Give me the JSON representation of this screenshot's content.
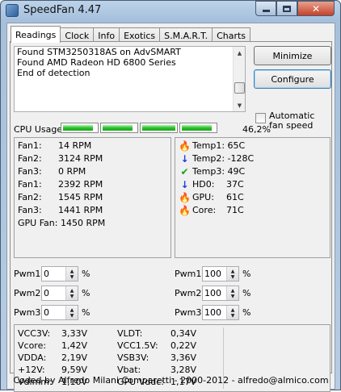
{
  "window": {
    "title": "SpeedFan 4.47",
    "title_icon": "speedfan-app-icon",
    "controls": [
      "minimize-window",
      "maximize-window",
      "close-window"
    ]
  },
  "tabs": [
    "Readings",
    "Clock",
    "Info",
    "Exotics",
    "S.M.A.R.T.",
    "Charts"
  ],
  "active_tab": "Readings",
  "log": {
    "lines": [
      "Found STM3250318AS on AdvSMART",
      "Found AMD Radeon HD 6800 Series",
      "End of detection"
    ]
  },
  "buttons": {
    "minimize": "Minimize",
    "configure": "Configure"
  },
  "auto_fan_speed": {
    "label": "Automatic fan speed",
    "checked": false
  },
  "cpu_usage": {
    "label": "CPU Usage",
    "bars": [
      0.9,
      0.9,
      1.0,
      0.9
    ],
    "percent": "46,2%"
  },
  "fans": [
    {
      "label": "Fan1:",
      "value": "14 RPM"
    },
    {
      "label": "Fan2:",
      "value": "3124 RPM"
    },
    {
      "label": "Fan3:",
      "value": "0 RPM"
    },
    {
      "label": "Fan1:",
      "value": "2392 RPM"
    },
    {
      "label": "Fan2:",
      "value": "1545 RPM"
    },
    {
      "label": "Fan3:",
      "value": "1441 RPM"
    },
    {
      "label": "GPU Fan:",
      "value": "1450 RPM"
    }
  ],
  "temps": [
    {
      "label": "Temp1:",
      "value": "65C",
      "icon": "flame-icon",
      "icon_color": "#e05a00"
    },
    {
      "label": "Temp2:",
      "value": "-128C",
      "icon": "arrow-down-icon",
      "icon_color": "#1a3fd8"
    },
    {
      "label": "Temp3:",
      "value": "49C",
      "icon": "check-icon",
      "icon_color": "#12a21b"
    },
    {
      "label": "HD0:",
      "value": "37C",
      "icon": "arrow-down-icon",
      "icon_color": "#1a3fd8"
    },
    {
      "label": "GPU:",
      "value": "61C",
      "icon": "flame-icon",
      "icon_color": "#e05a00"
    },
    {
      "label": "Core:",
      "value": "71C",
      "icon": "flame-icon",
      "icon_color": "#e05a00"
    }
  ],
  "pwm_left": [
    {
      "label": "Pwm1:",
      "value": "0",
      "unit": "%"
    },
    {
      "label": "Pwm2:",
      "value": "0",
      "unit": "%"
    },
    {
      "label": "Pwm3:",
      "value": "0",
      "unit": "%"
    }
  ],
  "pwm_right": [
    {
      "label": "Pwm1:",
      "value": "100",
      "unit": "%"
    },
    {
      "label": "Pwm2:",
      "value": "100",
      "unit": "%"
    },
    {
      "label": "Pwm3:",
      "value": "100",
      "unit": "%"
    }
  ],
  "voltages_left": [
    {
      "label": "VCC3V:",
      "value": "3,33V"
    },
    {
      "label": "Vcore:",
      "value": "1,42V"
    },
    {
      "label": "VDDA:",
      "value": "2,19V"
    },
    {
      "label": "+12V:",
      "value": "9,59V"
    },
    {
      "label": "Vdimm:",
      "value": "1,10V"
    }
  ],
  "voltages_right": [
    {
      "label": "VLDT:",
      "value": "0,34V"
    },
    {
      "label": "VCC1.5V:",
      "value": "0,22V"
    },
    {
      "label": "VSB3V:",
      "value": "3,36V"
    },
    {
      "label": "Vbat:",
      "value": "3,28V"
    },
    {
      "label": "GPU Vddc:",
      "value": "1,17V"
    }
  ],
  "footer": "Coded by Alfredo Milani Comparetti - 2000-2012 - alfredo@almico.com"
}
